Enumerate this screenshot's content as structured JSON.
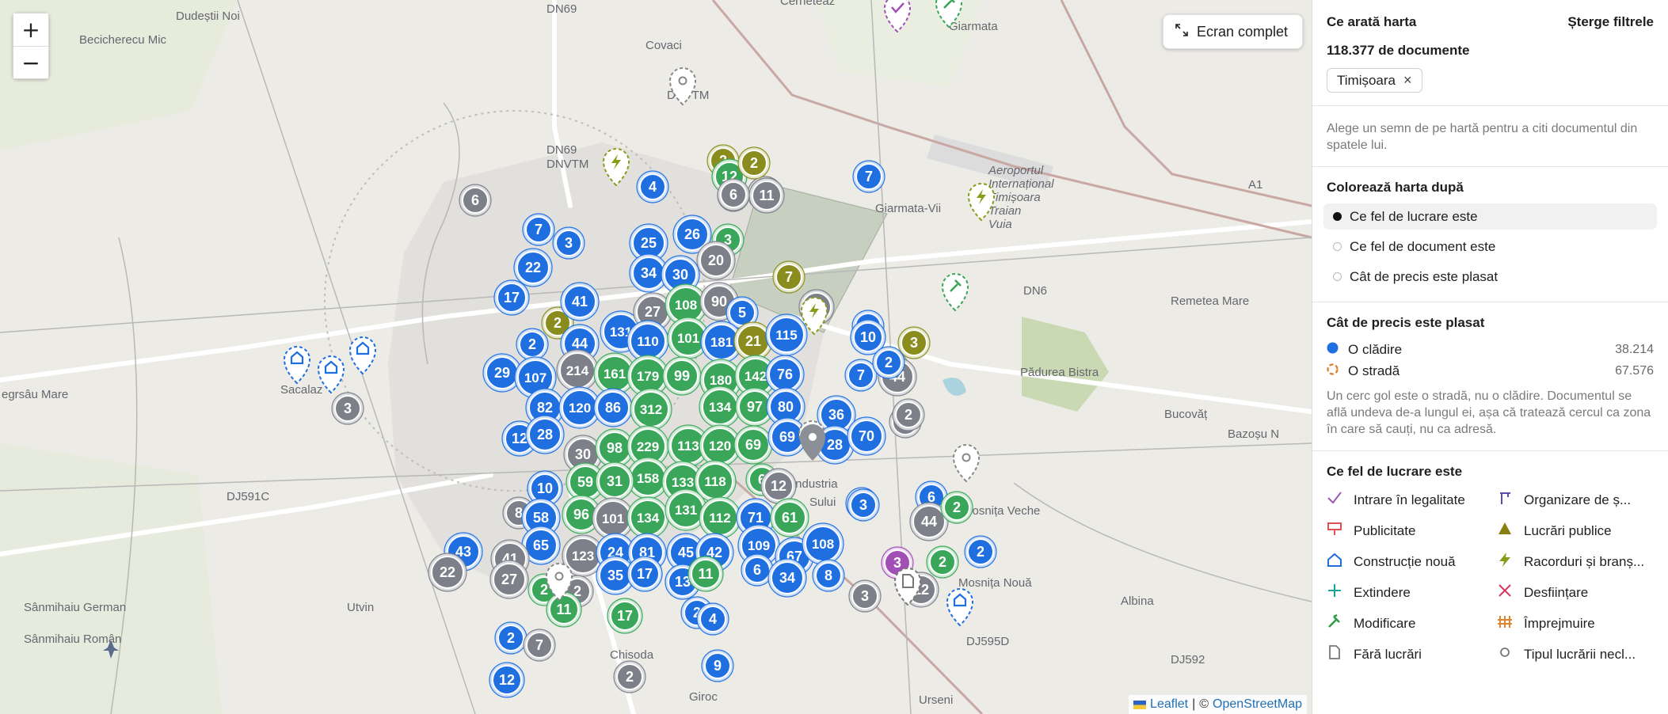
{
  "map": {
    "zoom_in": "+",
    "zoom_out": "−",
    "fullscreen_label": "Ecran complet",
    "attribution": {
      "leaflet": "Leaflet",
      "sep": "|",
      "copy": "©",
      "osm": "OpenStreetMap"
    },
    "places": [
      "Dudeștii Noi",
      "Becicherecu Mic",
      "DN69",
      "Covaci",
      "DNVTM",
      "DN69",
      "DNVTM",
      "Cerneteaz",
      "Giarmata",
      "Giarmata-Vii",
      "Aeroportul Internațional Timișoara Traian Vuia",
      "A1",
      "DN6",
      "Remetea Mare",
      "Pădurea Bistra",
      "Bucovăț",
      "Bazoșu N",
      "Sacalaz",
      "egrsâu Mare",
      "DJ591C",
      "Mosnița Veche",
      "Mosnița Nouă",
      "DJ595D",
      "Albina",
      "DJ592",
      "Sânmihaiu German",
      "Sânmihaiu Român",
      "Utvin",
      "Chisoda",
      "Giroc",
      "Urseni",
      "Industria",
      "Sului"
    ],
    "clusters": [
      {
        "label": "6"
      },
      {
        "label": "7"
      },
      {
        "label": "3"
      },
      {
        "label": "2"
      },
      {
        "label": "22"
      },
      {
        "label": "17"
      },
      {
        "label": "41"
      },
      {
        "label": "2"
      },
      {
        "label": "44"
      },
      {
        "label": "131"
      },
      {
        "label": "29"
      },
      {
        "label": "107"
      },
      {
        "label": "214"
      },
      {
        "label": "161"
      },
      {
        "label": "82"
      },
      {
        "label": "120"
      },
      {
        "label": "86"
      },
      {
        "label": "12"
      },
      {
        "label": "28"
      },
      {
        "label": "3"
      },
      {
        "label": "25"
      },
      {
        "label": "34"
      },
      {
        "label": "27"
      },
      {
        "label": "110"
      },
      {
        "label": "179"
      },
      {
        "label": "312"
      },
      {
        "label": "26"
      },
      {
        "label": "30"
      },
      {
        "label": "98"
      },
      {
        "label": "229"
      },
      {
        "label": "2"
      },
      {
        "label": "12"
      },
      {
        "label": "6"
      },
      {
        "label": "11"
      },
      {
        "label": "4"
      },
      {
        "label": "26"
      },
      {
        "label": "3"
      },
      {
        "label": "20"
      },
      {
        "label": "30"
      },
      {
        "label": "108"
      },
      {
        "label": "90"
      },
      {
        "label": "5"
      },
      {
        "label": "101"
      },
      {
        "label": "181"
      },
      {
        "label": "21"
      },
      {
        "label": "115"
      },
      {
        "label": "99"
      },
      {
        "label": "180"
      },
      {
        "label": "142"
      },
      {
        "label": "76"
      },
      {
        "label": "134"
      },
      {
        "label": "97"
      },
      {
        "label": "80"
      },
      {
        "label": "113"
      },
      {
        "label": "120"
      },
      {
        "label": "69"
      },
      {
        "label": "69"
      },
      {
        "label": "158"
      },
      {
        "label": "133"
      },
      {
        "label": "118"
      },
      {
        "label": "6"
      },
      {
        "label": "12"
      },
      {
        "label": "10"
      },
      {
        "label": "59"
      },
      {
        "label": "31"
      },
      {
        "label": "8"
      },
      {
        "label": "58"
      },
      {
        "label": "96"
      },
      {
        "label": "101"
      },
      {
        "label": "134"
      },
      {
        "label": "131"
      },
      {
        "label": "112"
      },
      {
        "label": "71"
      },
      {
        "label": "61"
      },
      {
        "label": "65"
      },
      {
        "label": "123"
      },
      {
        "label": "24"
      },
      {
        "label": "81"
      },
      {
        "label": "45"
      },
      {
        "label": "42"
      },
      {
        "label": "109"
      },
      {
        "label": "67"
      },
      {
        "label": "108"
      },
      {
        "label": "43"
      },
      {
        "label": "41"
      },
      {
        "label": "22"
      },
      {
        "label": "27"
      },
      {
        "label": "2"
      },
      {
        "label": "2"
      },
      {
        "label": "35"
      },
      {
        "label": "17"
      },
      {
        "label": "13"
      },
      {
        "label": "11"
      },
      {
        "label": "6"
      },
      {
        "label": "34"
      },
      {
        "label": "8"
      },
      {
        "label": "11"
      },
      {
        "label": "17"
      },
      {
        "label": "2"
      },
      {
        "label": "4"
      },
      {
        "label": "2"
      },
      {
        "label": "7"
      },
      {
        "label": "12"
      },
      {
        "label": "2"
      },
      {
        "label": "9"
      },
      {
        "label": "6"
      },
      {
        "label": "11"
      },
      {
        "label": "2"
      },
      {
        "label": "7"
      },
      {
        "label": "16"
      },
      {
        "label": "3"
      },
      {
        "label": "10"
      },
      {
        "label": "7"
      },
      {
        "label": "3"
      },
      {
        "label": "2"
      },
      {
        "label": "44"
      },
      {
        "label": "7"
      },
      {
        "label": "36"
      },
      {
        "label": "28"
      },
      {
        "label": "70"
      },
      {
        "label": "3"
      },
      {
        "label": "2"
      },
      {
        "label": "2"
      },
      {
        "label": "6"
      },
      {
        "label": "44"
      },
      {
        "label": "3"
      },
      {
        "label": "2"
      },
      {
        "label": "2"
      },
      {
        "label": "3"
      },
      {
        "label": "2"
      },
      {
        "label": "12"
      },
      {
        "label": "3"
      },
      {
        "label": "2"
      }
    ]
  },
  "panel": {
    "what_shows_title": "Ce arată harta",
    "clear_filters": "Șterge filtrele",
    "doc_count": "118.377 de documente",
    "filter_chip": "Timișoara",
    "filter_chip_remove": "×",
    "hint": "Alege un semn de pe hartă pentru a citi documentul din spatele lui.",
    "color_by_title": "Colorează harta după",
    "color_options": [
      "Ce fel de lucrare este",
      "Ce fel de document este",
      "Cât de precis este plasat"
    ],
    "precision_title": "Cât de precis este plasat",
    "precision_items": [
      {
        "label": "O clădire",
        "count": "38.214",
        "color": "#1f6fe0"
      },
      {
        "label": "O stradă",
        "count": "67.576",
        "color": "#e07a1f"
      }
    ],
    "precision_note": "Un cerc gol este o stradă, nu o clădire. Documentul se află undeva de-a lungul ei, așa că tratează cercul ca zona în care să cauți, nu ca adresă.",
    "work_type_title": "Ce fel de lucrare este",
    "work_types": [
      {
        "label": "Intrare în legalitate",
        "icon": "checkmark-icon",
        "color": "#9b59b6"
      },
      {
        "label": "Organizare de ș...",
        "icon": "site-organization-icon",
        "color": "#5b4bb0"
      },
      {
        "label": "Publicitate",
        "icon": "billboard-icon",
        "color": "#e05252"
      },
      {
        "label": "Lucrări publice",
        "icon": "triangle-icon",
        "color": "#8a7d12"
      },
      {
        "label": "Construcție nouă",
        "icon": "house-icon",
        "color": "#1f6fe0"
      },
      {
        "label": "Racorduri și branș...",
        "icon": "lightning-icon",
        "color": "#8a9a1a"
      },
      {
        "label": "Extindere",
        "icon": "plus-icon",
        "color": "#1aa39a"
      },
      {
        "label": "Desființare",
        "icon": "cross-icon",
        "color": "#d6345a"
      },
      {
        "label": "Modificare",
        "icon": "hammer-icon",
        "color": "#2e9a4a"
      },
      {
        "label": "Împrejmuire",
        "icon": "fence-icon",
        "color": "#e0832a"
      },
      {
        "label": "Fără lucrări",
        "icon": "document-icon",
        "color": "#777777"
      },
      {
        "label": "Tipul lucrării necl...",
        "icon": "circle-icon",
        "color": "#777777"
      }
    ]
  }
}
